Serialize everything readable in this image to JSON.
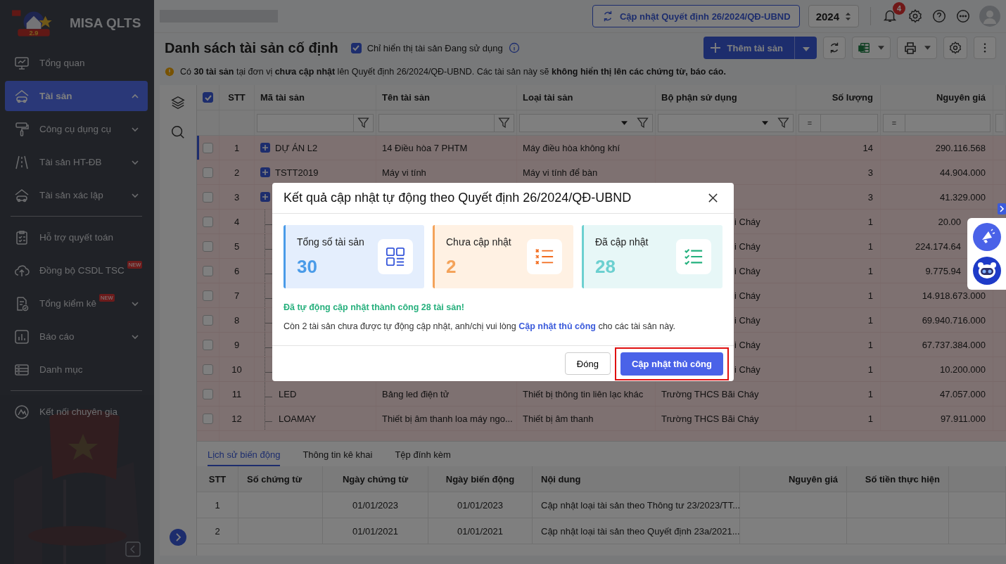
{
  "sidebar": {
    "logo_badge": "2.9",
    "app_name": "MISA QLTS",
    "sections": [
      [
        {
          "label": "Tổng quan",
          "kind": "link",
          "selected": false
        },
        {
          "label": "Tài sản",
          "kind": "group",
          "selected": true,
          "expanded": true
        },
        {
          "label": "Công cụ dụng cụ",
          "kind": "group",
          "selected": false,
          "expanded": false
        },
        {
          "label": "Tài sản HT-ĐB",
          "kind": "group",
          "selected": false,
          "expanded": false
        },
        {
          "label": "Tài sản xác lập",
          "kind": "group",
          "selected": false,
          "expanded": false
        }
      ],
      [
        {
          "label": "Hỗ trợ quyết toán",
          "kind": "link",
          "selected": false
        },
        {
          "label": "Đồng bộ CSDL TSC",
          "kind": "link",
          "selected": false,
          "badge": "NEW"
        },
        {
          "label": "Tổng kiểm kê",
          "kind": "group",
          "selected": false,
          "expanded": false,
          "badge": "NEW"
        },
        {
          "label": "Báo cáo",
          "kind": "group",
          "selected": false,
          "expanded": false
        },
        {
          "label": "Danh mục",
          "kind": "link",
          "selected": false
        }
      ],
      [
        {
          "label": "Kết nối chuyên gia",
          "kind": "link",
          "selected": false
        }
      ]
    ]
  },
  "top_bar": {
    "update_button": "Cập nhật Quyết định 26/2024/QĐ-UBND",
    "year": "2024",
    "notification_count": "4"
  },
  "page": {
    "title": "Danh sách tài sản cố định",
    "filter_checkbox": {
      "label": "Chỉ hiển thị tài sản Đang sử dụng",
      "checked": true
    },
    "add_button": "Thêm tài sản",
    "warning": "Có **30 tài sản** tại đơn vị **chưa cập nhật** lên Quyết định 26/2024/QĐ-UBND. Các tài sản này sẽ **không hiển thị lên các chứng từ, báo cáo.**"
  },
  "table": {
    "all_checked": true,
    "columns": [
      {
        "label": "STT",
        "kind": "plain"
      },
      {
        "label": "Mã tài sản",
        "kind": "text"
      },
      {
        "label": "Tên tài sản",
        "kind": "text"
      },
      {
        "label": "Loại tài sản",
        "kind": "select"
      },
      {
        "label": "Bộ phận sử dụng",
        "kind": "select"
      },
      {
        "label": "Số lượng",
        "kind": "number",
        "operator": "="
      },
      {
        "label": "Nguyên giá",
        "kind": "number",
        "operator": "="
      }
    ],
    "rows": [
      {
        "stt": "1",
        "kind": "parent",
        "selected": true,
        "checked": false,
        "covered": false,
        "cut": false,
        "code": "DỰ ÁN L2",
        "name": "14 Điều hòa 7 PHTM",
        "type": "Máy điều hòa không khí",
        "quantity": "14",
        "cost": "290.116.568"
      },
      {
        "stt": "2",
        "kind": "parent",
        "selected": false,
        "checked": false,
        "covered": false,
        "cut": false,
        "code": "TSTT2019",
        "name": "Máy vi tính",
        "type": "Máy vi tính để bàn",
        "quantity": "3",
        "cost": "44.904.000"
      },
      {
        "stt": "3",
        "kind": "parent",
        "selected": false,
        "checked": false,
        "covered": true,
        "cut": false,
        "quantity": "3",
        "cost": "41.329.000"
      },
      {
        "stt": "4",
        "kind": "child",
        "selected": false,
        "checked": false,
        "covered": true,
        "cut": true,
        "department": "i Cháy",
        "quantity": "1",
        "cost": "20.00"
      },
      {
        "stt": "5",
        "kind": "child",
        "selected": false,
        "checked": false,
        "covered": true,
        "cut": true,
        "department": "i Cháy",
        "quantity": "1",
        "cost": "224.174.64"
      },
      {
        "stt": "6",
        "kind": "child",
        "selected": false,
        "checked": false,
        "covered": true,
        "cut": true,
        "department": "i Cháy",
        "quantity": "1",
        "cost": "9.775.94"
      },
      {
        "stt": "7",
        "kind": "child",
        "selected": false,
        "checked": false,
        "covered": true,
        "cut": false,
        "department": "i Cháy",
        "quantity": "1",
        "cost": "14.918.673.000"
      },
      {
        "stt": "8",
        "kind": "child",
        "selected": false,
        "checked": false,
        "covered": true,
        "cut": false,
        "department": "i Cháy",
        "quantity": "1",
        "cost": "69.940.716.000"
      },
      {
        "stt": "9",
        "kind": "child",
        "selected": false,
        "checked": false,
        "covered": true,
        "cut": false,
        "department": "i Cháy",
        "quantity": "1",
        "cost": "67.737.384.000"
      },
      {
        "stt": "10",
        "kind": "child",
        "selected": false,
        "checked": false,
        "covered": true,
        "cut": false,
        "department": "i Cháy",
        "quantity": "1",
        "cost": "10.200.000"
      },
      {
        "stt": "11",
        "kind": "child",
        "selected": false,
        "checked": false,
        "covered": false,
        "cut": false,
        "code": "LED",
        "name": "Bảng led điện tử",
        "type": "Thiết bị thông tin liên lạc khác",
        "department": "Trường THCS Bãi Cháy",
        "quantity": "1",
        "cost": "47.057.000"
      },
      {
        "stt": "12",
        "kind": "child",
        "selected": false,
        "checked": false,
        "covered": false,
        "cut": false,
        "code": "LOAMAY",
        "name": "Thiết bị âm thanh loa máy ngo...",
        "type": "Thiết bị âm thanh",
        "department": "Trường THCS Bãi Cháy",
        "quantity": "1",
        "cost": "97.911.000"
      }
    ]
  },
  "detail_panel": {
    "tabs": [
      {
        "label": "Lịch sử biến động",
        "selected": true
      },
      {
        "label": "Thông tin kê khai",
        "selected": false
      },
      {
        "label": "Tệp đính kèm",
        "selected": false
      }
    ],
    "columns": [
      "STT",
      "Số chứng từ",
      "Ngày chứng từ",
      "Ngày biến động",
      "Nội dung",
      "Nguyên giá",
      "Số tiền thực hiện"
    ],
    "rows": [
      {
        "stt": "1",
        "voucher_date": "01/01/2023",
        "change_date": "01/01/2023",
        "content": "Cập nhật loại tài sản theo Thông tư 23/2023/TT..."
      },
      {
        "stt": "2",
        "voucher_date": "01/01/2021",
        "change_date": "01/01/2021",
        "content": "Cập nhật loại tài sản theo Quyết định 23a/2021..."
      }
    ]
  },
  "dialog": {
    "title": "Kết quả cập nhật tự động theo Quyết định 26/2024/QĐ-UBND",
    "cards": [
      {
        "label": "Tổng số tài sản",
        "value": "30",
        "color": "#4a9be8"
      },
      {
        "label": "Chưa cập nhật",
        "value": "2",
        "color": "#f4a35a"
      },
      {
        "label": "Đã cập nhật",
        "value": "28",
        "color": "#6cd0d0"
      }
    ],
    "success_message": "Đã tự động cập nhật thành công 28 tài sản!",
    "note": {
      "before": "Còn 2 tài sản chưa được tự động cập nhật, anh/chị vui lòng ",
      "link": "Cập nhật thủ công",
      "after": " cho các tài sản này."
    },
    "close_button": "Đóng",
    "primary_button": "Cập nhật thủ công",
    "primary_highlighted": true
  }
}
